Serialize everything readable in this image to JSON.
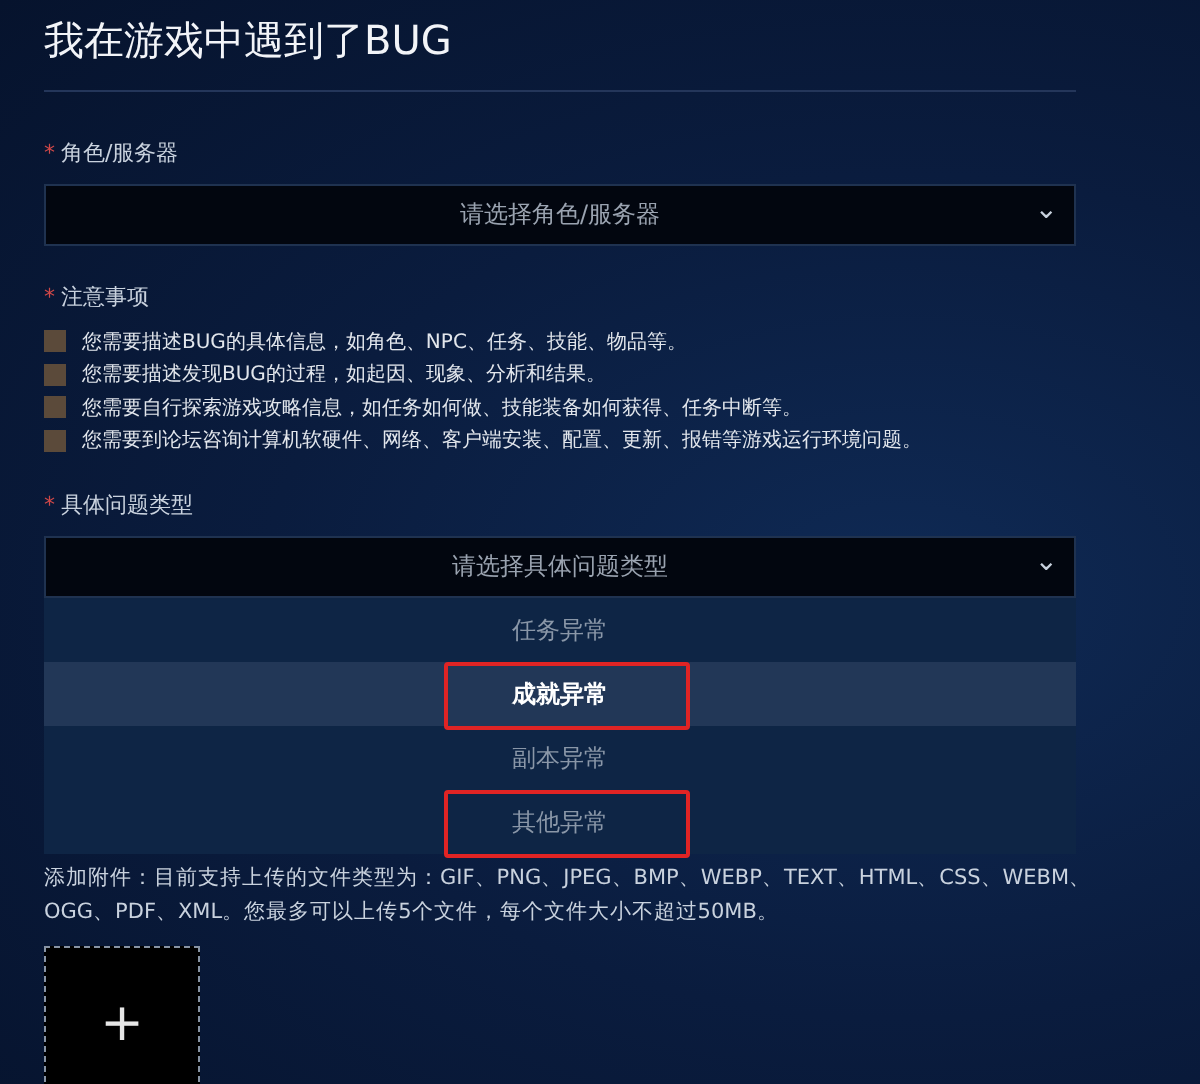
{
  "title": "我在游戏中遇到了BUG",
  "role_field": {
    "label": "角色/服务器",
    "required_mark": "*",
    "placeholder": "请选择角色/服务器",
    "caret": "⌄"
  },
  "notes": {
    "label": "注意事项",
    "required_mark": "*",
    "items": [
      {
        "text": "您需要描述BUG的具体信息，如角色、NPC、任务、技能、物品等。",
        "checked": false
      },
      {
        "text": "您需要描述发现BUG的过程，如起因、现象、分析和结果。",
        "checked": false
      },
      {
        "text": "您需要自行探索游戏攻略信息，如任务如何做、技能装备如何获得、任务中断等。",
        "checked": false
      },
      {
        "text": "您需要到论坛咨询计算机软硬件、网络、客户端安装、配置、更新、报错等游戏运行环境问题。",
        "checked": false
      }
    ]
  },
  "type_field": {
    "label": "具体问题类型",
    "required_mark": "*",
    "placeholder": "请选择具体问题类型",
    "caret": "⌄",
    "options": [
      {
        "label": "任务异常",
        "selected": false,
        "marked": false
      },
      {
        "label": "成就异常",
        "selected": true,
        "marked": true
      },
      {
        "label": "副本异常",
        "selected": false,
        "marked": false
      },
      {
        "label": "其他异常",
        "selected": false,
        "marked": true
      }
    ]
  },
  "attachment": {
    "hint": "添加附件：目前支持上传的文件类型为：GIF、PNG、JPEG、BMP、WEBP、TEXT、HTML、CSS、WEBM、OGG、PDF、XML。您最多可以上传5个文件，每个文件大小不超过50MB。",
    "upload_symbol": "+"
  }
}
